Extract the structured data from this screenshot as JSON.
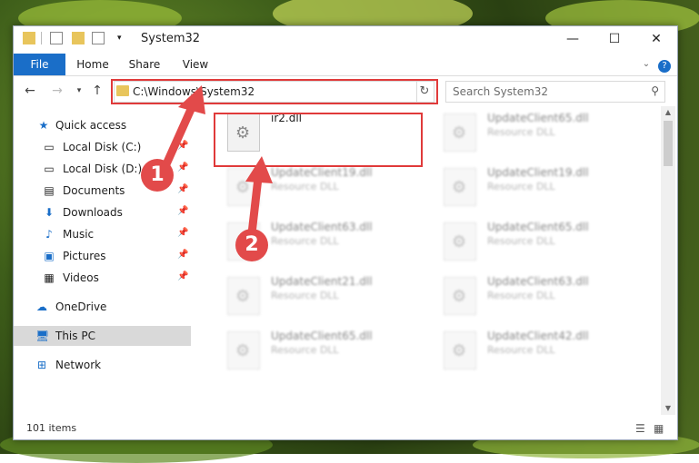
{
  "window": {
    "title": "System32",
    "controls": {
      "minimize": "—",
      "maximize": "☐",
      "close": "✕"
    }
  },
  "ribbon": {
    "tabs": [
      "File",
      "Home",
      "Share",
      "View"
    ]
  },
  "address": {
    "path": "C:\\Windows\\System32",
    "search_placeholder": "Search System32"
  },
  "sidebar": {
    "items": [
      {
        "label": "Quick access",
        "icon": "star-icon"
      },
      {
        "label": "Local Disk (C:)",
        "icon": "drive-icon"
      },
      {
        "label": "Local Disk (D:)",
        "icon": "drive-icon"
      },
      {
        "label": "Documents",
        "icon": "document-icon"
      },
      {
        "label": "Downloads",
        "icon": "download-icon"
      },
      {
        "label": "Music",
        "icon": "music-icon"
      },
      {
        "label": "Pictures",
        "icon": "picture-icon"
      },
      {
        "label": "Videos",
        "icon": "video-icon"
      },
      {
        "label": "OneDrive",
        "icon": "cloud-icon"
      },
      {
        "label": "This PC",
        "icon": "computer-icon"
      },
      {
        "label": "Network",
        "icon": "network-icon"
      }
    ]
  },
  "files": [
    {
      "name": "ir2.dll",
      "type": ""
    },
    {
      "name": "UpdateClient65.dll",
      "type": "Resource DLL"
    },
    {
      "name": "UpdateClient19.dll",
      "type": "Resource DLL"
    },
    {
      "name": "UpdateClient19.dll",
      "type": "Resource DLL"
    },
    {
      "name": "UpdateClient63.dll",
      "type": "Resource DLL"
    },
    {
      "name": "UpdateClient65.dll",
      "type": "Resource DLL"
    },
    {
      "name": "UpdateClient21.dll",
      "type": "Resource DLL"
    },
    {
      "name": "UpdateClient63.dll",
      "type": "Resource DLL"
    },
    {
      "name": "UpdateClient65.dll",
      "type": "Resource DLL"
    },
    {
      "name": "UpdateClient42.dll",
      "type": "Resource DLL"
    }
  ],
  "status": {
    "item_count": "101 items"
  },
  "annotations": {
    "step1": "1",
    "step2": "2"
  },
  "colors": {
    "accent": "#1a6ec8",
    "highlight": "#e03a3a"
  }
}
